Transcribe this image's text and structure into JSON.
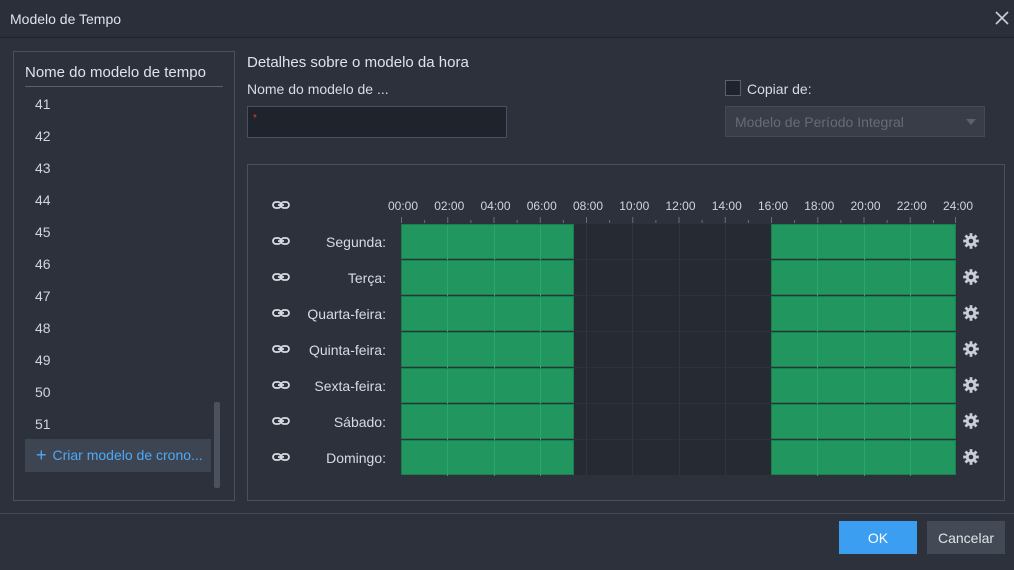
{
  "window": {
    "title": "Modelo de Tempo"
  },
  "list": {
    "header": "Nome do modelo de tempo",
    "items": [
      "41",
      "42",
      "43",
      "44",
      "45",
      "46",
      "47",
      "48",
      "49",
      "50",
      "51"
    ],
    "create_label": "Criar modelo de crono..."
  },
  "details": {
    "title": "Detalhes sobre o modelo da hora",
    "name_label": "Nome do modelo de ...",
    "name_required_mark": "*",
    "copy_label": "Copiar de:",
    "copy_selected": "Modelo de Período Integral"
  },
  "schedule": {
    "time_labels": [
      "00:00",
      "02:00",
      "04:00",
      "06:00",
      "08:00",
      "10:00",
      "12:00",
      "14:00",
      "16:00",
      "18:00",
      "20:00",
      "22:00",
      "24:00"
    ],
    "days": [
      "Segunda:",
      "Terça:",
      "Quarta-feira:",
      "Quinta-feira:",
      "Sexta-feira:",
      "Sábado:",
      "Domingo:"
    ],
    "active_periods_hours": [
      [
        0,
        7.5
      ],
      [
        16,
        24
      ]
    ],
    "active_color": "#21965e"
  },
  "footer": {
    "ok_label": "OK",
    "cancel_label": "Cancelar"
  },
  "colors": {
    "accent": "#3b9ef0",
    "link": "#4ea9f4"
  }
}
